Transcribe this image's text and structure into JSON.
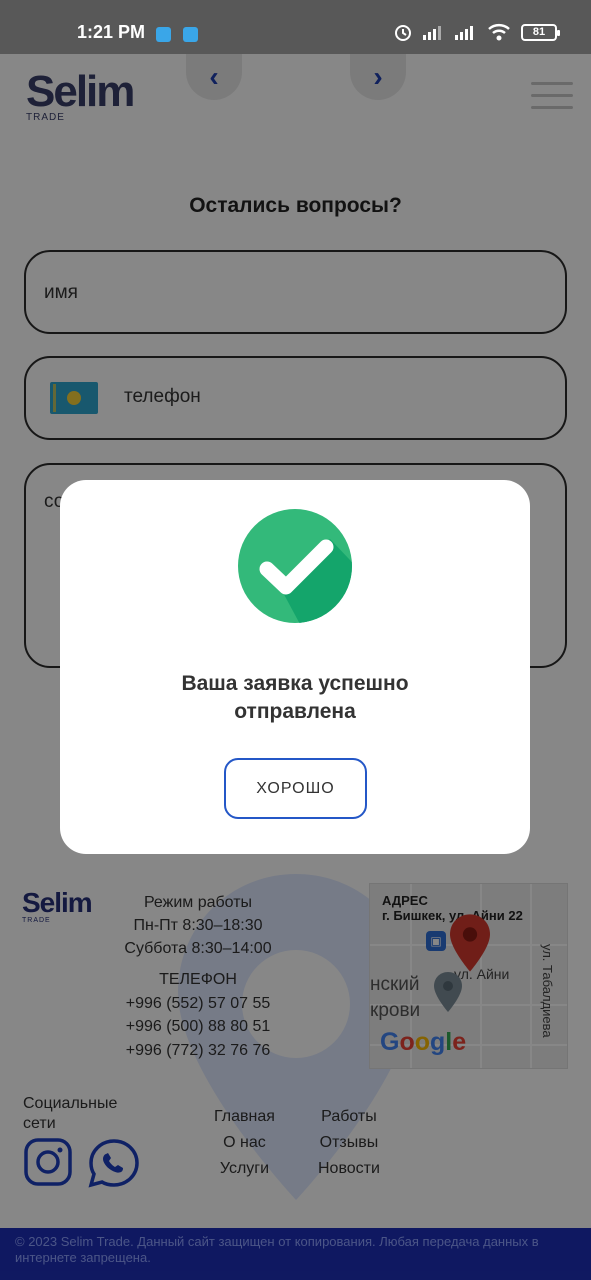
{
  "status_bar": {
    "time": "1:21 PM",
    "battery": "81"
  },
  "header": {
    "logo_text": "Selim",
    "logo_sub": "TRADE",
    "prev_arrow": "‹",
    "next_arrow": "›"
  },
  "form": {
    "title": "Остались вопросы?",
    "name_placeholder": "имя",
    "phone_placeholder": "телефон",
    "message_placeholder": "со"
  },
  "modal": {
    "message": "Ваша заявка успешно отправлена",
    "ok_label": "ХОРОШО"
  },
  "footer": {
    "logo_text": "Selim",
    "logo_sub": "TRADE",
    "hours_title": "Режим работы",
    "hours_weekdays": "Пн-Пт 8:30–18:30",
    "hours_saturday": "Суббота 8:30–14:00",
    "phone_title": "ТЕЛЕФОН",
    "phones": [
      "+996 (552) 57 07 55",
      "+996 (500) 88 80 51",
      "+996 (772) 32 76 76"
    ],
    "map": {
      "address_label": "АДРЕС",
      "address": "г. Бишкек, ул. Айни 22",
      "street_1": "ул. Айни",
      "street_2": "ул. Табалдиева",
      "street_3_line1": "нский",
      "street_3_line2": "крови",
      "brand": "Google"
    },
    "social_label": "Социальные сети",
    "links": {
      "col1": [
        "Главная",
        "О нас",
        "Услуги"
      ],
      "col2": [
        "Работы",
        "Отзывы",
        "Новости"
      ]
    },
    "copyright": "© 2023 Selim Trade. Данный сайт защищен от копирования. Любая передача данных в интернете запрещена."
  },
  "colors": {
    "accent": "#2457c7",
    "success": "#33b97a",
    "footer_bar": "#1e2fb8"
  }
}
